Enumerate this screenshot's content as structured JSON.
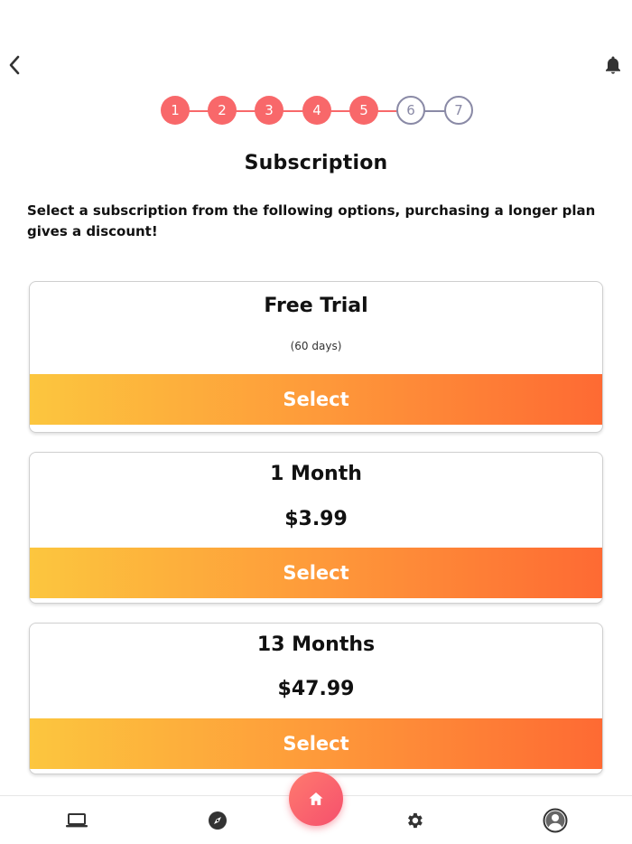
{
  "header": {
    "back_icon": "chevron-left-icon",
    "bell_icon": "bell-icon"
  },
  "stepper": {
    "steps": [
      {
        "label": "1",
        "state": "done"
      },
      {
        "label": "2",
        "state": "done"
      },
      {
        "label": "3",
        "state": "done"
      },
      {
        "label": "4",
        "state": "done"
      },
      {
        "label": "5",
        "state": "done"
      },
      {
        "label": "6",
        "state": "todo"
      },
      {
        "label": "7",
        "state": "todo"
      }
    ],
    "done_color": "#f8686a",
    "todo_color": "#8a8aa6"
  },
  "page": {
    "title": "Subscription",
    "intro": "Select a subscription from the following options, purchasing a longer plan gives a discount!"
  },
  "plans": [
    {
      "name": "Free Trial",
      "detail": "(60 days)",
      "button": "Select"
    },
    {
      "name": "1 Month",
      "price": "$3.99",
      "button": "Select"
    },
    {
      "name": "13 Months",
      "price": "$47.99",
      "button": "Select"
    }
  ],
  "bottom_nav": {
    "items": [
      {
        "icon": "laptop-icon"
      },
      {
        "icon": "compass-icon"
      },
      {
        "icon": "home-icon"
      },
      {
        "icon": "gear-icon"
      },
      {
        "icon": "profile-avatar-icon"
      }
    ],
    "home_color": "#f5506d"
  },
  "colors": {
    "gradient_start": "#fcc63e",
    "gradient_end": "#fe6a33"
  }
}
